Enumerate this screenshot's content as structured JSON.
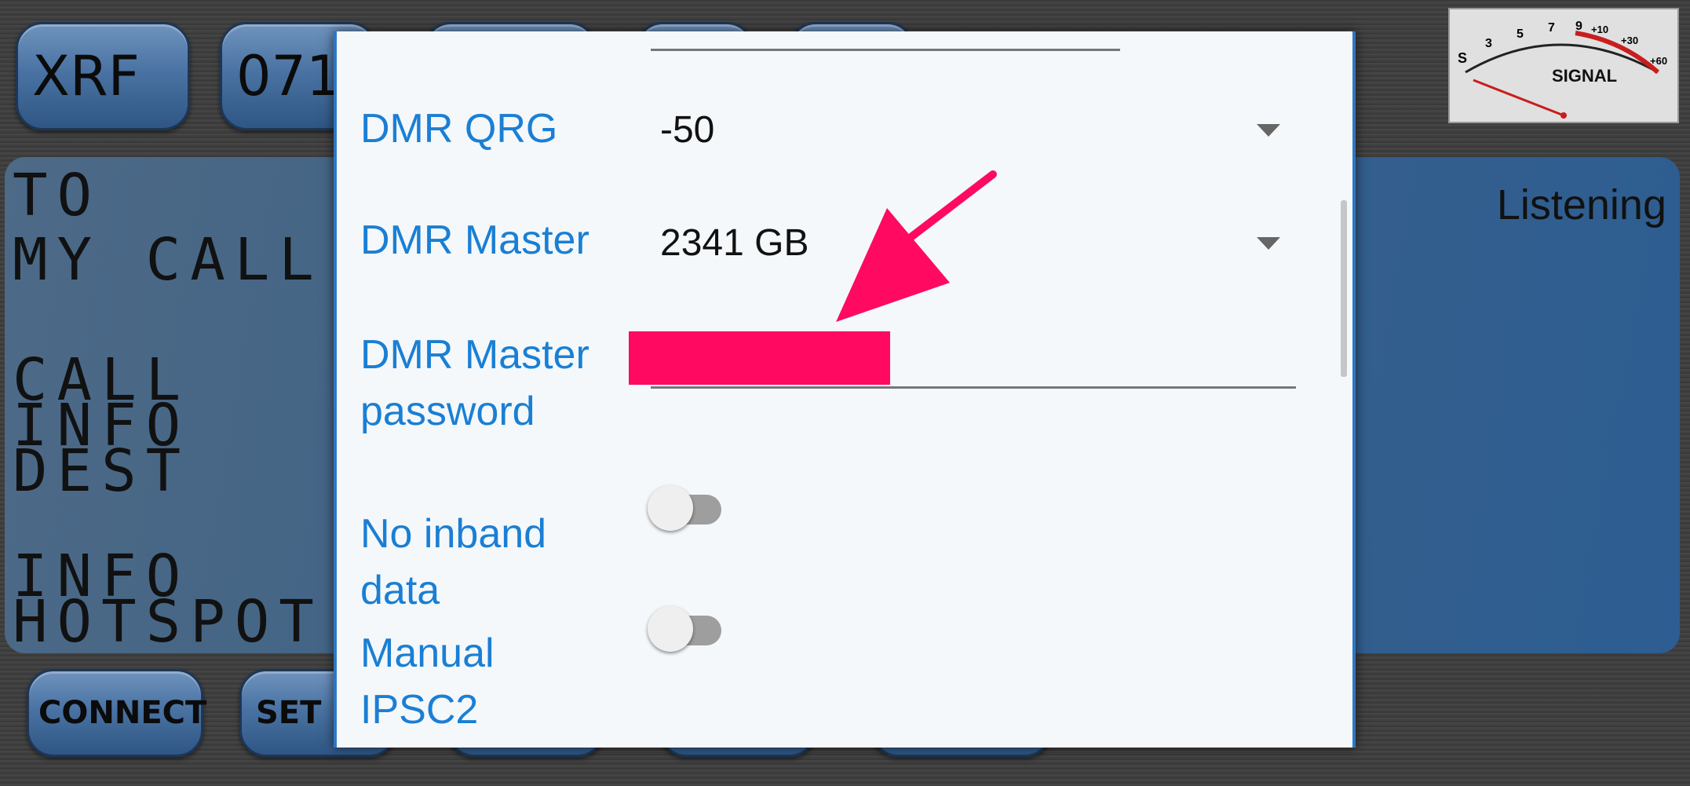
{
  "top_bar": {
    "reflector_label": "XRF",
    "module_label": "071"
  },
  "display": {
    "lcd_lines": [
      "TO",
      "MY CALL",
      "",
      "CALL",
      "INFO",
      "DEST",
      "",
      "INFO",
      "HOTSPOT"
    ],
    "status": "Listening"
  },
  "meter": {
    "title": "SIGNAL",
    "scale": [
      "S",
      "3",
      "5",
      "7",
      "9",
      "+10",
      "+30",
      "+60"
    ]
  },
  "bottom_bar": {
    "connect_label": "CONNECT",
    "settings_label": "SET"
  },
  "dialog": {
    "dmr_qrg": {
      "label": "DMR QRG",
      "value": "-50"
    },
    "dmr_master": {
      "label": "DMR Master",
      "value": "2341 GB"
    },
    "dmr_master_password": {
      "label_line1": "DMR Master",
      "label_line2": "password"
    },
    "no_inband_data": {
      "label_line1": "No inband",
      "label_line2": "data",
      "checked": false
    },
    "manual_ipsc2": {
      "label_line1": "Manual",
      "label_line2": "IPSC2",
      "checked": false
    }
  },
  "colors": {
    "label_blue": "#1a7fd4",
    "annotation_pink": "#ff0a60",
    "dialog_bg": "#f4f8fb"
  }
}
